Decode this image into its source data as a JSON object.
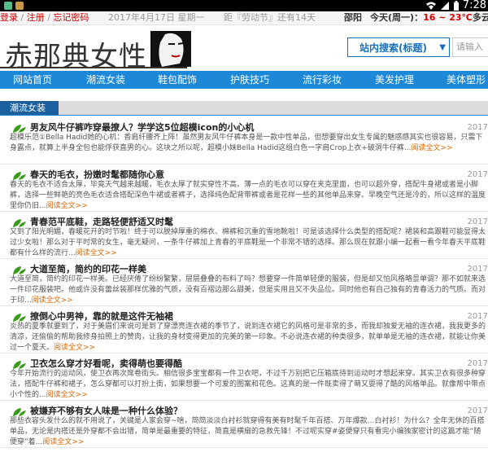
{
  "status": {
    "time": "7:28"
  },
  "topbar": {
    "login": "登录",
    "register": "注册",
    "forgot": "忘记密码",
    "date": "2017年4月17日 星期一",
    "festival": "距『劳动节』还有14天",
    "city": "邵阳",
    "weather_label": "今天(周一)：",
    "temp": "16 ~ 23℃",
    "weather_tail": "多云"
  },
  "header": {
    "site_name": "赤那典女性",
    "search_select": "站内搜索(标题)",
    "search_placeholder": "请输入"
  },
  "nav": [
    "网站首页",
    "潮流女装",
    "鞋包配饰",
    "护肤技巧",
    "流行彩妆",
    "美发护理",
    "美体塑形"
  ],
  "section": {
    "title": "潮流女装"
  },
  "articles": [
    {
      "title": "男友风牛仔裤咋穿最撩人？学学这5位超模icon的小心机",
      "date": "2017",
      "summary": "超模乐范①Bella Hadid她的心机：香肩纤腰齐上阵！虽然男友风牛仔裤本身是一款中性单品，但想要穿出女生专属的魅惑感其实也很容易，只需下身露点，就算上半身全包也能俘获直男的心。这块之所以呢，超模小妹Bella Hadid这组白色一字肩Crop上衣+破洞牛仔裤...",
      "more": "阅读全文>>"
    },
    {
      "title": "春天的毛衣，扮嫩时髦都随你心意",
      "date": "2017",
      "summary": "春天的毛衣不适合太厚，毕竟天气越来越暖，毛衣太厚了就实穿性不高。薄一点的毛衣可以穿在夹克里面，也可以超外穿，搭配牛身裙或者是小脚裤，选择一些鲜艳的亮色毛衣适合搭配深色牛裙或者裤子，选择纯色配背带裤或者是花样一些的其他单品来穿。早晚空气还是冷的，所以这样的温度里你仍旧...",
      "more": "阅读全文>>"
    },
    {
      "title": "青春范平底鞋，走路轻便舒适又时髦",
      "date": "2017",
      "summary": "又到了阳光明媚，春暖花开的时节啦！终于可以脱掉厚重的棉衣、棉裤和沉重的雪地靴啦！可是该选择什么类型的搭配呢？裙装和高跟鞋可能显得太过少女啦！那么对于平时常的女生，毫无疑问，一条牛仔裤加上青春的平底鞋是一个非常不错的选择。那么现在就跟小编一起看一看今年春天平底鞋都有什么样的流行...",
      "more": "阅读全文>>"
    },
    {
      "title": "大道至简，简约的印花一样美",
      "date": "2017",
      "summary": "大道至简，简约的印花一样美。已经厌倦了纷纷繁繁，层层叠叠的布料了吗？想要穿一件简单轻便的服装，但是却又怕风格略显单调？那不如就来选一件印花服装吧。他或许没有蕾丝装那样优雅的气质，没有百褶边那么甜美，但是实用且又不失品位。同时他也有自己独有的青春活力的气质。而对于印...",
      "more": "阅读全文>>"
    },
    {
      "title": "撩倒心中男神，靠的就是这件无袖裙",
      "date": "2017",
      "summary": "炎热的夏季就要到了，对于美眉们来说可是到了穿漂亮连衣裙的季节了，说到连衣裙它的风格可是非常的多，而我却独爱无袖的连衣裙，我我更多的清凉，还偷偷的帮助我修身拍照上的赞肉，让我的身材变得更加的完美的第一印象。不必说连衣裙的种类很多，就单单是无袖的连衣裙，就能让你美过一个夏天。",
      "more": "阅读全文>>"
    },
    {
      "title": "卫衣怎么穿才好看呢，卖得萌也要得酷",
      "date": "2017",
      "summary": "今年开始流行的运动风，使卫衣再次席卷街头。相信很多宝宝都有一件卫衣吧，不过千万别把它压箱底待到运动时才想起来穿。其实卫衣有很多种穿法，搭配牛仔裤和裙子，怎么穿都可以打扮上街，如果想要一个可爱的图案和花色。这真的是一件既卖得了萌又耍得了酷的风格单品。就像帮中带点小个性的...",
      "more": "阅读全文>>"
    },
    {
      "title": "被嫌弃不够有女人味是一种什么体验？",
      "date": "2017",
      "summary": "那些衣容头发什么的就不用说了，关键是人家会穿~啥，简简淡淡白衬衫就穿得有美有时髦千年百搭、万年爆款…白衬衫！为什么？全年无休的百搭单品，无论是内搭还是外穿都不会出错，简单是最重要的特征，简直是横扇的急救先锋！不过呢实穿#姿便穿只有看完小编独家密计的这篇才能“随便穿”着...",
      "more": "阅读全文>>"
    }
  ]
}
